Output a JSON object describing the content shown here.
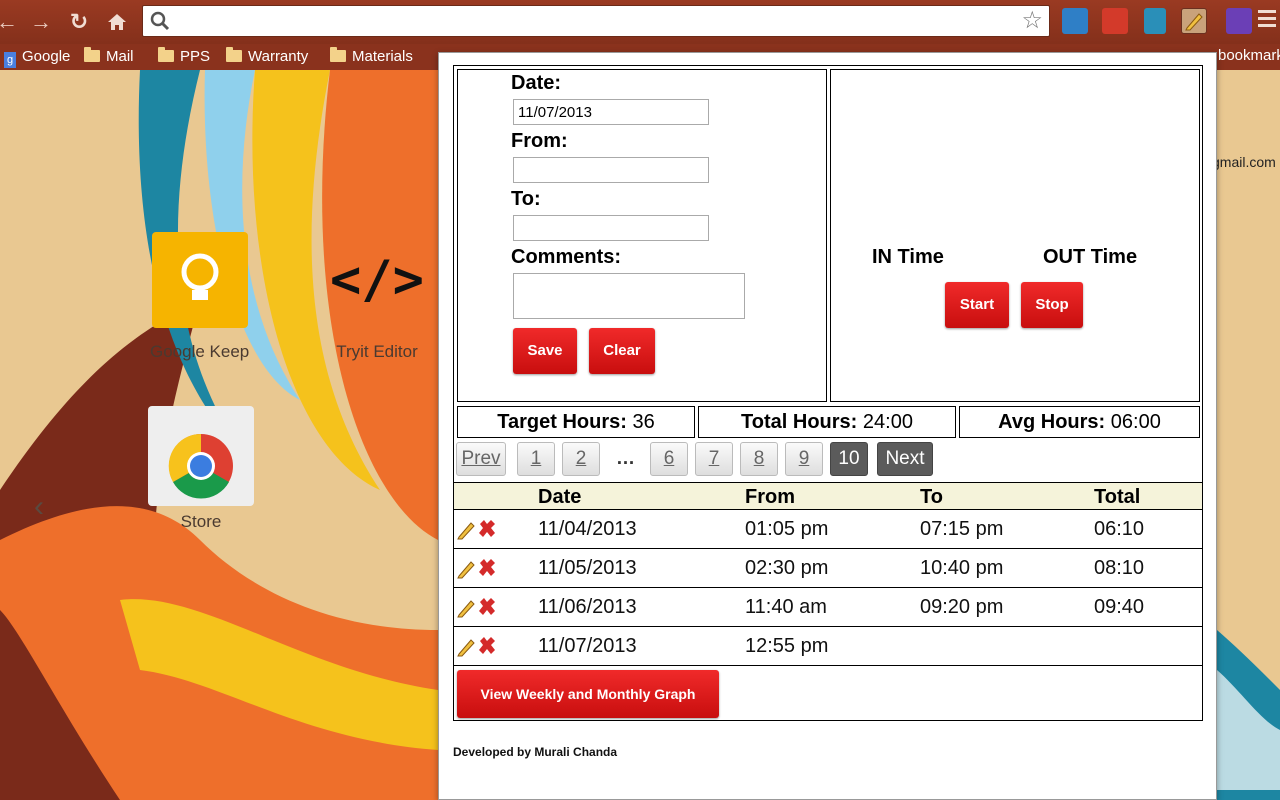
{
  "browser": {
    "url": "",
    "bookmarks": [
      {
        "label": "Google",
        "kind": "site"
      },
      {
        "label": "Mail",
        "kind": "folder"
      },
      {
        "label": "PPS",
        "kind": "folder"
      },
      {
        "label": "Warranty",
        "kind": "folder"
      },
      {
        "label": "Materials",
        "kind": "folder"
      }
    ],
    "bookmarks_overflow": "bookmark",
    "account_snippet": "gmail.com"
  },
  "ntp": {
    "apps": [
      {
        "label": "Google Keep"
      },
      {
        "label": "Tryit Editor"
      },
      {
        "label": "Store"
      }
    ],
    "nav_prev": "‹"
  },
  "form": {
    "date_label": "Date:",
    "date_value": "11/07/2013",
    "from_label": "From:",
    "from_value": "",
    "to_label": "To:",
    "to_value": "",
    "comments_label": "Comments:",
    "comments_value": "",
    "save_label": "Save",
    "clear_label": "Clear"
  },
  "timer": {
    "in_label": "IN Time",
    "out_label": "OUT Time",
    "start_label": "Start",
    "stop_label": "Stop"
  },
  "stats": {
    "target_label": "Target Hours:",
    "target_value": "36",
    "total_label": "Total Hours:",
    "total_value": "24:00",
    "avg_label": "Avg Hours:",
    "avg_value": "06:00"
  },
  "pager": {
    "prev": "Prev",
    "pages": [
      "1",
      "2",
      "6",
      "7",
      "8",
      "9",
      "10"
    ],
    "ellipsis": "…",
    "current": "10",
    "next": "Next"
  },
  "table": {
    "headers": [
      "Date",
      "From",
      "To",
      "Total"
    ],
    "rows": [
      {
        "date": "11/04/2013",
        "from": "01:05 pm",
        "to": "07:15 pm",
        "total": "06:10"
      },
      {
        "date": "11/05/2013",
        "from": "02:30 pm",
        "to": "10:40 pm",
        "total": "08:10"
      },
      {
        "date": "11/06/2013",
        "from": "11:40 am",
        "to": "09:20 pm",
        "total": "09:40"
      },
      {
        "date": "11/07/2013",
        "from": "12:55 pm",
        "to": "",
        "total": ""
      }
    ]
  },
  "graph_button": "View Weekly and Monthly Graph",
  "credit": "Developed by Murali Chanda",
  "colors": {
    "accent_red": "#e01a1a",
    "toolbar": "#8a321d",
    "table_header": "#f5f3da",
    "pager_current": "#5b5b5b"
  }
}
